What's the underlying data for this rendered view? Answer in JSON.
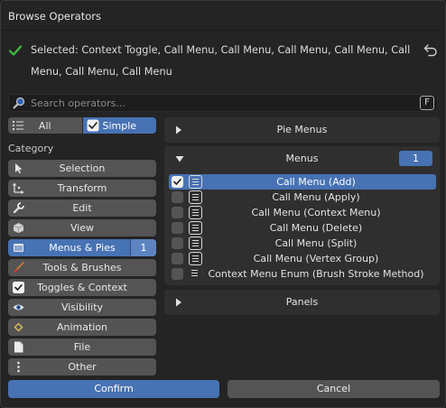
{
  "dialog": {
    "title": "Browse Operators",
    "selected_text": "Selected: Context Toggle, Call Menu, Call Menu, Call Menu, Call Menu, Call Menu, Call Menu, Call Menu"
  },
  "search": {
    "placeholder": "Search operators...",
    "shortcut": "F"
  },
  "filter": {
    "all_label": "All",
    "simple_label": "Simple",
    "active": "Simple"
  },
  "category_heading": "Category",
  "categories": [
    {
      "label": "Selection",
      "icon": "cursor-arrow-icon"
    },
    {
      "label": "Transform",
      "icon": "transform-axes-icon"
    },
    {
      "label": "Edit",
      "icon": "wrench-icon"
    },
    {
      "label": "View",
      "icon": "cube-icon"
    },
    {
      "label": "Menus & Pies",
      "icon": "window-icon",
      "count": "1",
      "active": true
    },
    {
      "label": "Tools & Brushes",
      "icon": "brush-icon"
    },
    {
      "label": "Toggles & Context",
      "icon": "checkbox-icon"
    },
    {
      "label": "Visibility",
      "icon": "eye-icon"
    },
    {
      "label": "Animation",
      "icon": "keyframe-diamond-icon"
    },
    {
      "label": "File",
      "icon": "file-icon"
    },
    {
      "label": "Other",
      "icon": "more-vertical-icon"
    }
  ],
  "sections": {
    "pie_menus": {
      "label": "Pie Menus",
      "expanded": false
    },
    "menus": {
      "label": "Menus",
      "count": "1",
      "expanded": true
    },
    "panels": {
      "label": "Panels",
      "expanded": false
    }
  },
  "operators": [
    {
      "label": "Call Menu (Add)",
      "checked": true,
      "selected": true
    },
    {
      "label": "Call Menu (Apply)",
      "checked": false
    },
    {
      "label": "Call Menu (Context Menu)",
      "checked": false
    },
    {
      "label": "Call Menu (Delete)",
      "checked": false
    },
    {
      "label": "Call Menu (Split)",
      "checked": false
    },
    {
      "label": "Call Menu (Vertex Group)",
      "checked": false
    },
    {
      "label": "Context Menu Enum (Brush Stroke Method)",
      "checked": false
    }
  ],
  "buttons": {
    "confirm": "Confirm",
    "cancel": "Cancel"
  },
  "colors": {
    "accent": "#4772b3",
    "success": "#3fbf3f",
    "background": "#242424",
    "button": "#545454"
  }
}
